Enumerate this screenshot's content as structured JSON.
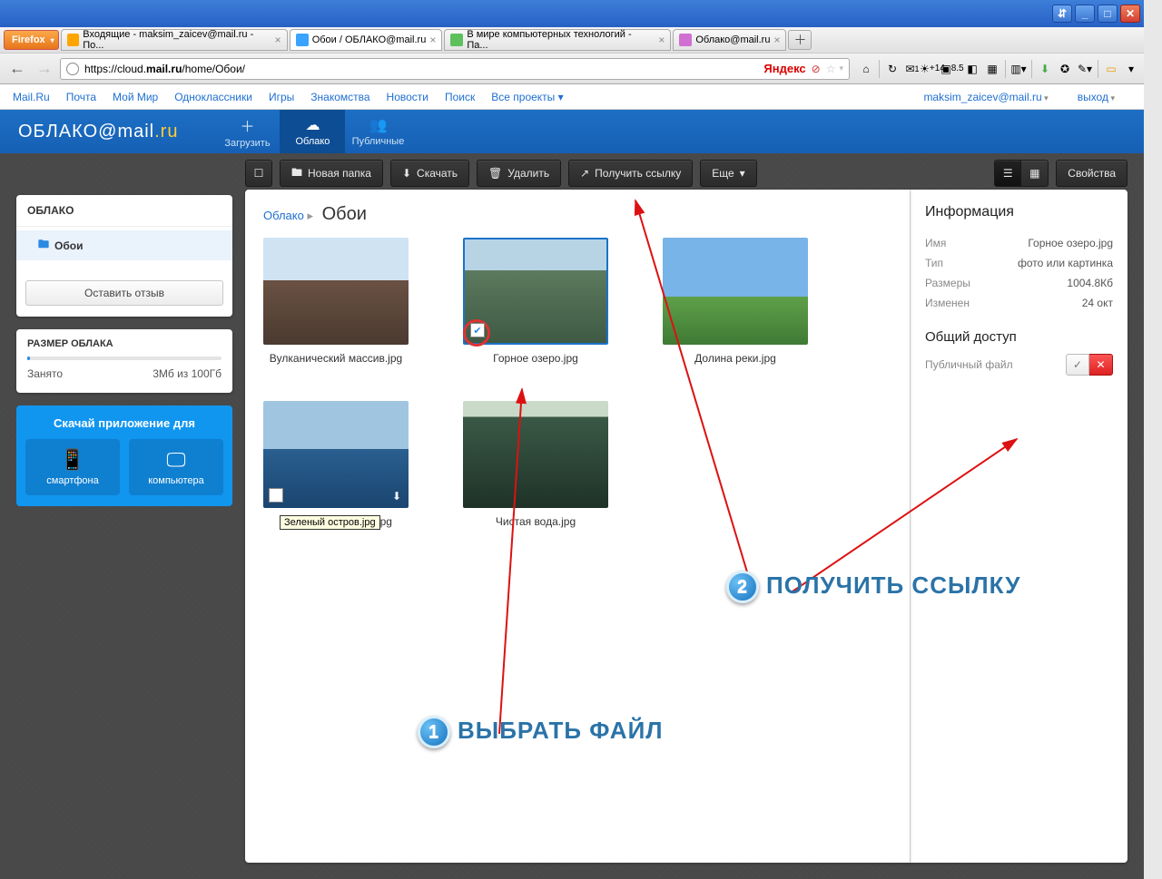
{
  "window": {
    "min": "_",
    "max": "□",
    "close": "✕",
    "extra": "⇵"
  },
  "firefox_button": "Firefox",
  "tabs": [
    {
      "label": "Входящие - maksim_zaicev@mail.ru - По...",
      "fav": "#ffa500"
    },
    {
      "label": "Обои / ОБЛАКО@mail.ru",
      "fav": "#3aa3ff",
      "active": true
    },
    {
      "label": "В мире компьютерных технологий - Па...",
      "fav": "#5cc05c"
    },
    {
      "label": "Облако@mail.ru",
      "fav": "#d070d0"
    }
  ],
  "url": "https://cloud.mail.ru/home/Обои/",
  "url_display_prefix": "https://cloud.",
  "url_display_bold": "mail.ru",
  "url_display_suffix": "/home/Обои/",
  "searchbrand": "Яндекс",
  "toolbar_extra": {
    "mail_count": "1",
    "weather": "+14",
    "rating": "8.5"
  },
  "mru_nav": [
    "Mail.Ru",
    "Почта",
    "Мой Мир",
    "Одноклассники",
    "Игры",
    "Знакомства",
    "Новости",
    "Поиск",
    "Все проекты"
  ],
  "mru_user": "maksim_zaicev@mail.ru",
  "mru_exit": "выход",
  "cloud_logo_a": "ОБЛАКО@",
  "cloud_logo_b": "mail",
  "cloud_logo_c": ".ru",
  "hdr_tabs": [
    {
      "icon": "＋",
      "label": "Загрузить"
    },
    {
      "icon": "☁",
      "label": "Облако",
      "active": true
    },
    {
      "icon": "👥",
      "label": "Публичные"
    }
  ],
  "toolbar": {
    "new_folder": "Новая папка",
    "download": "Скачать",
    "delete": "Удалить",
    "getlink": "Получить ссылку",
    "more": "Еще",
    "props": "Свойства"
  },
  "tree_title": "ОБЛАКО",
  "tree_item": "Обои",
  "feedback": "Оставить отзыв",
  "size": {
    "title": "РАЗМЕР ОБЛАКА",
    "used_label": "Занято",
    "used_value": "3Мб из 100Гб"
  },
  "promo": {
    "title": "Скачай приложение для",
    "phone": "смартфона",
    "pc": "компьютера"
  },
  "breadcrumb": {
    "root": "Облако",
    "current": "Обои"
  },
  "files": [
    {
      "name": "Вулканический массив.jpg",
      "thumb": "t1"
    },
    {
      "name": "Горное озеро.jpg",
      "thumb": "t2",
      "selected": true
    },
    {
      "name": "Долина реки.jpg",
      "thumb": "t3"
    },
    {
      "name": "",
      "thumb": "t4",
      "hover": true,
      "tooltip": "Зеленый остров.jpg"
    },
    {
      "name": "Чистая вода.jpg",
      "thumb": "t5"
    }
  ],
  "info": {
    "title": "Информация",
    "rows": [
      {
        "k": "Имя",
        "v": "Горное озеро.jpg"
      },
      {
        "k": "Тип",
        "v": "фото или картинка"
      },
      {
        "k": "Размеры",
        "v": "1004.8Кб"
      },
      {
        "k": "Изменен",
        "v": "24 окт"
      }
    ],
    "share_title": "Общий доступ",
    "share_label": "Публичный файл",
    "ok": "✓",
    "del": "✕"
  },
  "anno": {
    "step1": "ВЫБРАТЬ ФАЙЛ",
    "step2": "ПОЛУЧИТЬ ССЫЛКУ",
    "n1": "1",
    "n2": "2"
  }
}
